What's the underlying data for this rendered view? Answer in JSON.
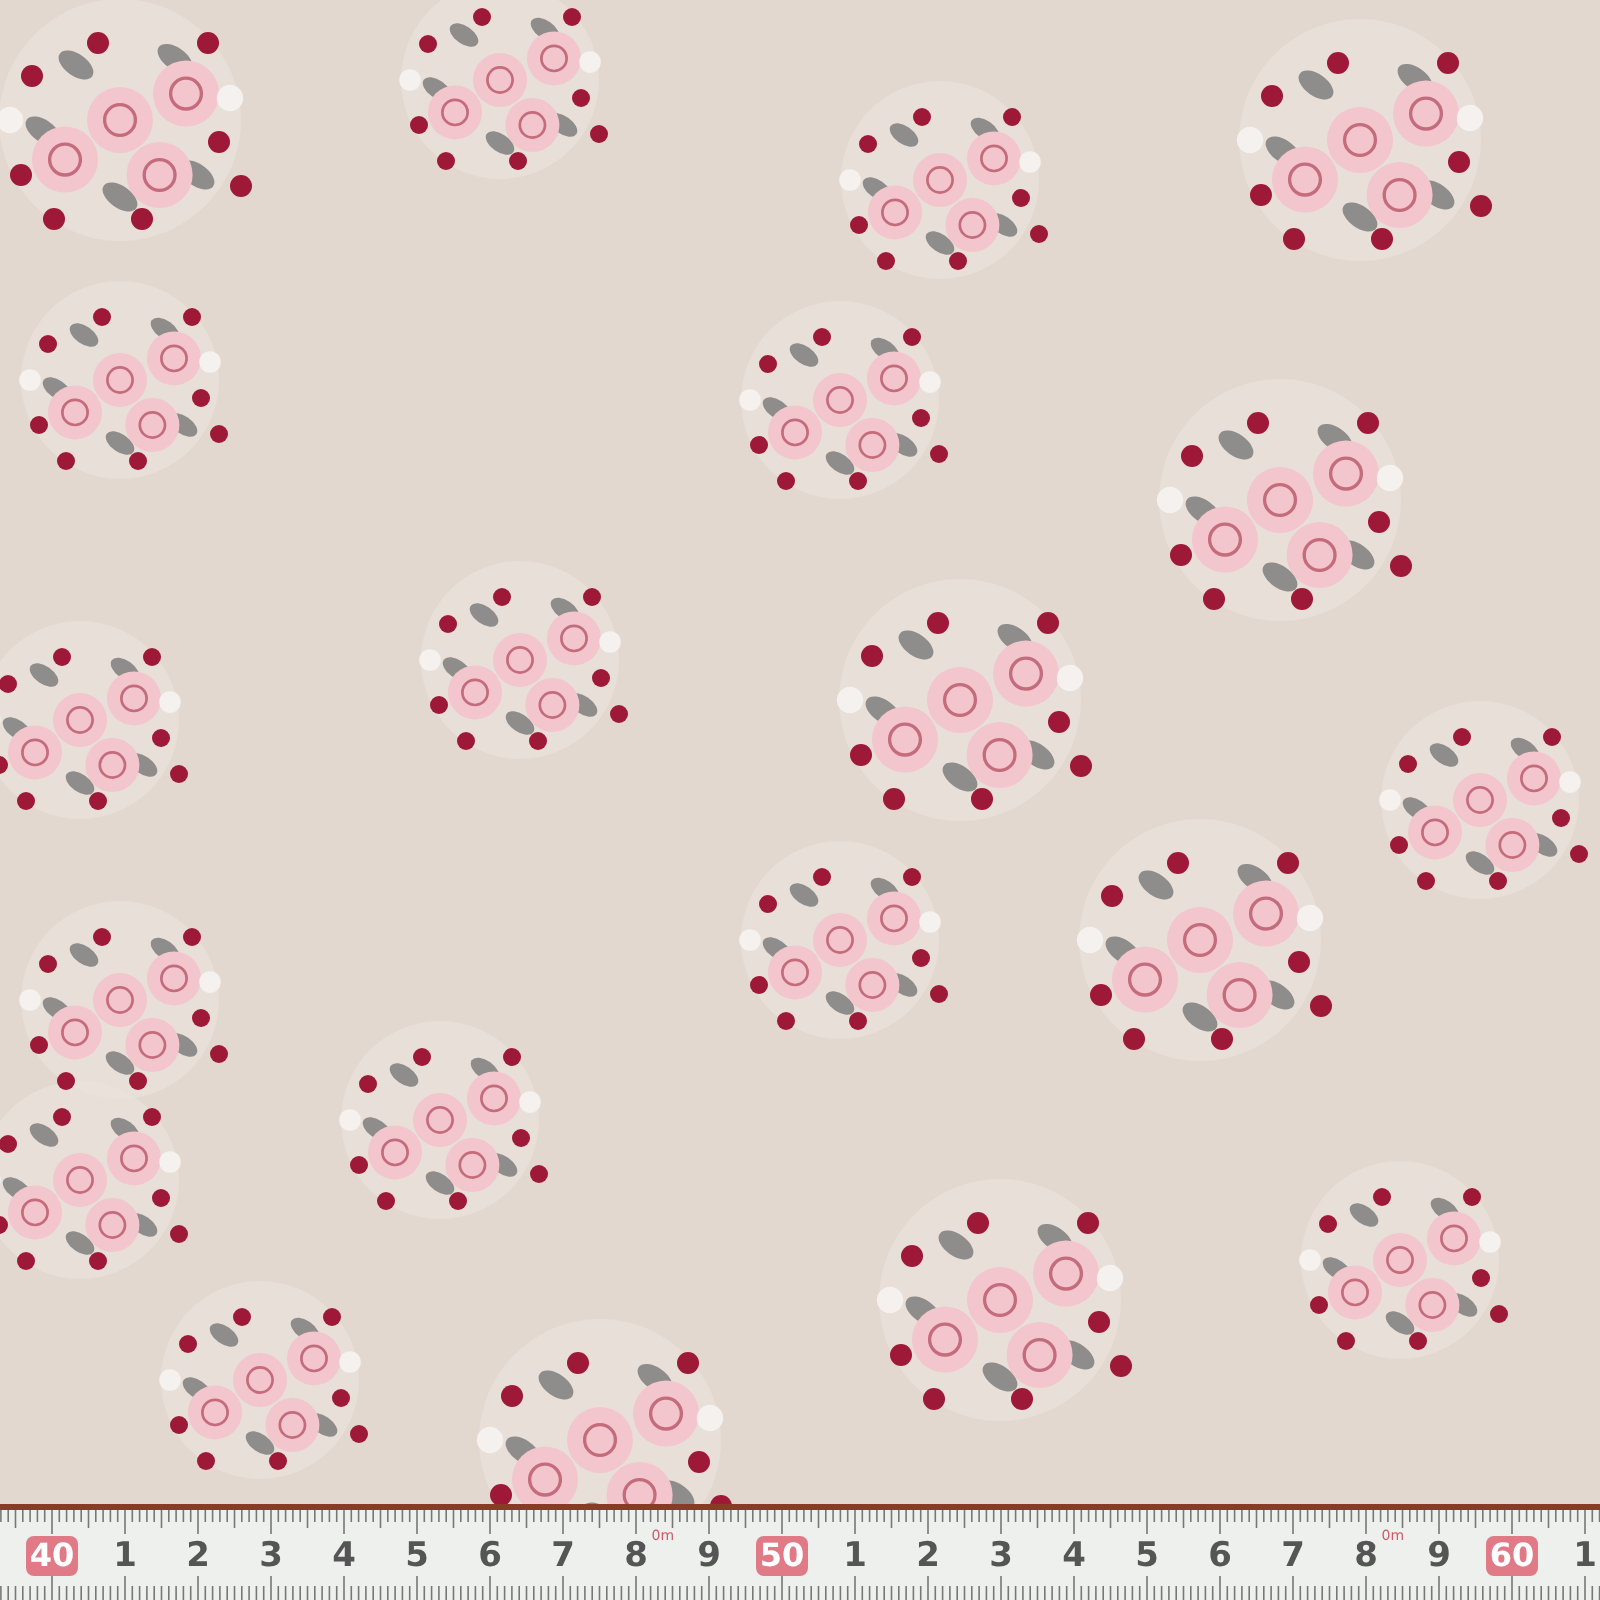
{
  "ruler": {
    "labels": [
      {
        "text": "40",
        "kind": "major"
      },
      {
        "text": "1",
        "kind": "minor"
      },
      {
        "text": "2",
        "kind": "minor"
      },
      {
        "text": "3",
        "kind": "minor"
      },
      {
        "text": "4",
        "kind": "minor"
      },
      {
        "text": "5",
        "kind": "minor"
      },
      {
        "text": "6",
        "kind": "minor"
      },
      {
        "text": "7",
        "kind": "minor"
      },
      {
        "text": "8",
        "kind": "minor",
        "note": "0m"
      },
      {
        "text": "9",
        "kind": "minor"
      },
      {
        "text": "50",
        "kind": "major"
      },
      {
        "text": "1",
        "kind": "minor"
      },
      {
        "text": "2",
        "kind": "minor"
      },
      {
        "text": "3",
        "kind": "minor"
      },
      {
        "text": "4",
        "kind": "minor"
      },
      {
        "text": "5",
        "kind": "minor"
      },
      {
        "text": "6",
        "kind": "minor"
      },
      {
        "text": "7",
        "kind": "minor"
      },
      {
        "text": "8",
        "kind": "minor",
        "note": "0m"
      },
      {
        "text": "9",
        "kind": "minor"
      },
      {
        "text": "60",
        "kind": "major"
      },
      {
        "text": "1",
        "kind": "minor"
      }
    ]
  }
}
